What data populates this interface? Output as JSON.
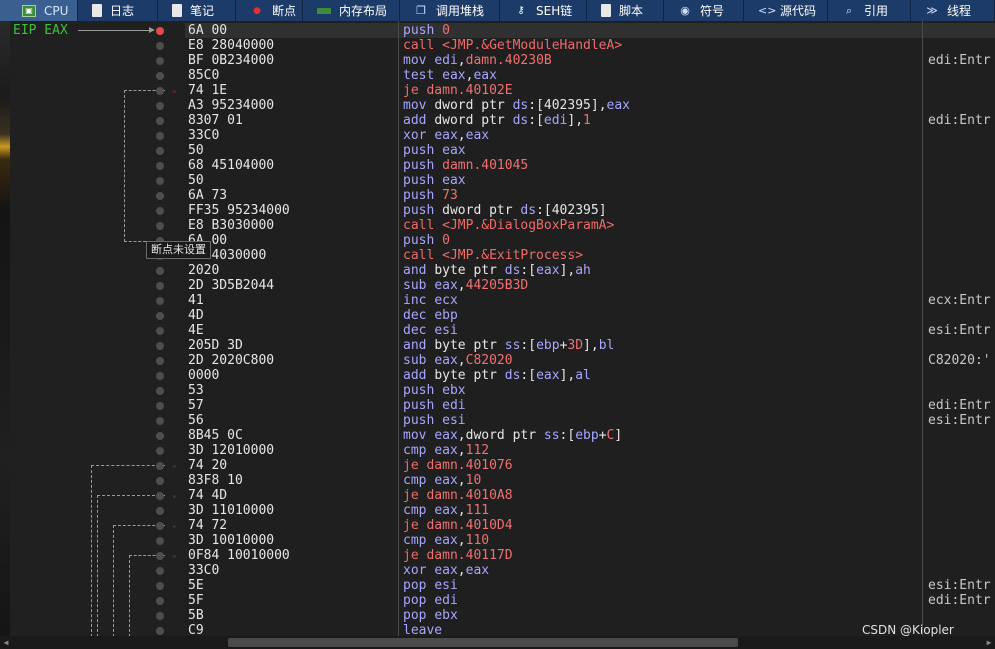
{
  "tabs": [
    {
      "label": "CPU",
      "icon": "cpu-icon",
      "active": true
    },
    {
      "label": "日志",
      "icon": "log-icon"
    },
    {
      "label": "笔记",
      "icon": "notes-icon"
    },
    {
      "label": "断点",
      "icon": "breakpoint-icon"
    },
    {
      "label": "内存布局",
      "icon": "memory-map-icon"
    },
    {
      "label": "调用堆栈",
      "icon": "call-stack-icon"
    },
    {
      "label": "SEH链",
      "icon": "seh-chain-icon"
    },
    {
      "label": "脚本",
      "icon": "script-icon"
    },
    {
      "label": "符号",
      "icon": "symbols-icon"
    },
    {
      "label": "源代码",
      "icon": "source-code-icon"
    },
    {
      "label": "引用",
      "icon": "references-icon"
    },
    {
      "label": "线程",
      "icon": "threads-icon"
    }
  ],
  "eip_label": "EIP EAX",
  "tooltip": "断点未设置",
  "watermark": "CSDN @Kiopler",
  "rows": [
    {
      "bytes": "6A 00",
      "op": "push",
      "args": [
        {
          "t": "0",
          "c": "arg-red"
        }
      ],
      "cmt": "",
      "bp": true
    },
    {
      "bytes": "E8 28040000",
      "op": "call",
      "kind": "call",
      "args": [
        {
          "t": "<JMP.&GetModuleHandleA>",
          "c": "op-call"
        }
      ],
      "cmt": ""
    },
    {
      "bytes": "BF 0B234000",
      "op": "mov",
      "args": [
        {
          "t": "edi",
          "c": "op-norm"
        },
        {
          "t": ",",
          "c": "arg"
        },
        {
          "t": "damn.40230B",
          "c": "arg-red"
        }
      ],
      "cmt": "edi:Entr"
    },
    {
      "bytes": "85C0",
      "op": "test",
      "args": [
        {
          "t": "eax",
          "c": "op-norm"
        },
        {
          "t": ",",
          "c": "arg"
        },
        {
          "t": "eax",
          "c": "op-norm"
        }
      ],
      "cmt": ""
    },
    {
      "bytes": "74 1E",
      "op": "je",
      "kind": "jmp",
      "args": [
        {
          "t": "damn.40102E",
          "c": "arg-red"
        }
      ],
      "cmt": ""
    },
    {
      "bytes": "A3 95234000",
      "op": "mov",
      "args": [
        {
          "t": "dword ptr ",
          "c": "arg"
        },
        {
          "t": "ds",
          "c": "op-norm"
        },
        {
          "t": ":[402395],",
          "c": "arg"
        },
        {
          "t": "eax",
          "c": "op-norm"
        }
      ],
      "cmt": ""
    },
    {
      "bytes": "8307 01",
      "op": "add",
      "args": [
        {
          "t": "dword ptr ",
          "c": "arg"
        },
        {
          "t": "ds",
          "c": "op-norm"
        },
        {
          "t": ":[",
          "c": "arg"
        },
        {
          "t": "edi",
          "c": "op-norm"
        },
        {
          "t": "],",
          "c": "arg"
        },
        {
          "t": "1",
          "c": "arg-red"
        }
      ],
      "cmt": "edi:Entr"
    },
    {
      "bytes": "33C0",
      "op": "xor",
      "args": [
        {
          "t": "eax",
          "c": "op-norm"
        },
        {
          "t": ",",
          "c": "arg"
        },
        {
          "t": "eax",
          "c": "op-norm"
        }
      ],
      "cmt": ""
    },
    {
      "bytes": "50",
      "op": "push",
      "args": [
        {
          "t": "eax",
          "c": "op-norm"
        }
      ],
      "cmt": ""
    },
    {
      "bytes": "68 45104000",
      "op": "push",
      "args": [
        {
          "t": "damn.401045",
          "c": "arg-red"
        }
      ],
      "cmt": ""
    },
    {
      "bytes": "50",
      "op": "push",
      "args": [
        {
          "t": "eax",
          "c": "op-norm"
        }
      ],
      "cmt": ""
    },
    {
      "bytes": "6A 73",
      "op": "push",
      "args": [
        {
          "t": "73",
          "c": "arg-red"
        }
      ],
      "cmt": ""
    },
    {
      "bytes": "FF35 95234000",
      "op": "push",
      "args": [
        {
          "t": "dword ptr ",
          "c": "arg"
        },
        {
          "t": "ds",
          "c": "op-norm"
        },
        {
          "t": ":[402395]",
          "c": "arg"
        }
      ],
      "cmt": ""
    },
    {
      "bytes": "E8 B3030000",
      "op": "call",
      "kind": "call",
      "args": [
        {
          "t": "<JMP.&DialogBoxParamA>",
          "c": "op-call"
        }
      ],
      "cmt": ""
    },
    {
      "bytes": "6A 00",
      "op": "push",
      "args": [
        {
          "t": "0",
          "c": "arg-red"
        }
      ],
      "cmt": ""
    },
    {
      "bytes": "E8 4030000",
      "op": "call",
      "kind": "call",
      "args": [
        {
          "t": "<JMP.&ExitProcess>",
          "c": "op-call"
        }
      ],
      "cmt": ""
    },
    {
      "bytes": "2020",
      "op": "and",
      "args": [
        {
          "t": "byte ptr ",
          "c": "arg"
        },
        {
          "t": "ds",
          "c": "op-norm"
        },
        {
          "t": ":[",
          "c": "arg"
        },
        {
          "t": "eax",
          "c": "op-norm"
        },
        {
          "t": "],",
          "c": "arg"
        },
        {
          "t": "ah",
          "c": "op-norm"
        }
      ],
      "cmt": ""
    },
    {
      "bytes": "2D 3D5B2044",
      "op": "sub",
      "args": [
        {
          "t": "eax",
          "c": "op-norm"
        },
        {
          "t": ",",
          "c": "arg"
        },
        {
          "t": "44205B3D",
          "c": "arg-red"
        }
      ],
      "cmt": ""
    },
    {
      "bytes": "41",
      "op": "inc",
      "args": [
        {
          "t": "ecx",
          "c": "op-norm"
        }
      ],
      "cmt": "ecx:Entr"
    },
    {
      "bytes": "4D",
      "op": "dec",
      "args": [
        {
          "t": "ebp",
          "c": "op-norm"
        }
      ],
      "cmt": ""
    },
    {
      "bytes": "4E",
      "op": "dec",
      "args": [
        {
          "t": "esi",
          "c": "op-norm"
        }
      ],
      "cmt": "esi:Entr"
    },
    {
      "bytes": "205D 3D",
      "op": "and",
      "args": [
        {
          "t": "byte ptr ",
          "c": "arg"
        },
        {
          "t": "ss",
          "c": "op-norm"
        },
        {
          "t": ":[",
          "c": "arg"
        },
        {
          "t": "ebp",
          "c": "op-norm"
        },
        {
          "t": "+",
          "c": "arg"
        },
        {
          "t": "3D",
          "c": "arg-red"
        },
        {
          "t": "],",
          "c": "arg"
        },
        {
          "t": "bl",
          "c": "op-norm"
        }
      ],
      "cmt": ""
    },
    {
      "bytes": "2D 2020C800",
      "op": "sub",
      "args": [
        {
          "t": "eax",
          "c": "op-norm"
        },
        {
          "t": ",",
          "c": "arg"
        },
        {
          "t": "C82020",
          "c": "arg-red"
        }
      ],
      "cmt": "C82020:'"
    },
    {
      "bytes": "0000",
      "op": "add",
      "args": [
        {
          "t": "byte ptr ",
          "c": "arg"
        },
        {
          "t": "ds",
          "c": "op-norm"
        },
        {
          "t": ":[",
          "c": "arg"
        },
        {
          "t": "eax",
          "c": "op-norm"
        },
        {
          "t": "],",
          "c": "arg"
        },
        {
          "t": "al",
          "c": "op-norm"
        }
      ],
      "cmt": ""
    },
    {
      "bytes": "53",
      "op": "push",
      "args": [
        {
          "t": "ebx",
          "c": "op-norm"
        }
      ],
      "cmt": ""
    },
    {
      "bytes": "57",
      "op": "push",
      "args": [
        {
          "t": "edi",
          "c": "op-norm"
        }
      ],
      "cmt": "edi:Entr"
    },
    {
      "bytes": "56",
      "op": "push",
      "args": [
        {
          "t": "esi",
          "c": "op-norm"
        }
      ],
      "cmt": "esi:Entr"
    },
    {
      "bytes": "8B45 0C",
      "op": "mov",
      "args": [
        {
          "t": "eax",
          "c": "op-norm"
        },
        {
          "t": ",dword ptr ",
          "c": "arg"
        },
        {
          "t": "ss",
          "c": "op-norm"
        },
        {
          "t": ":[",
          "c": "arg"
        },
        {
          "t": "ebp",
          "c": "op-norm"
        },
        {
          "t": "+",
          "c": "arg"
        },
        {
          "t": "C",
          "c": "arg-red"
        },
        {
          "t": "]",
          "c": "arg"
        }
      ],
      "cmt": ""
    },
    {
      "bytes": "3D 12010000",
      "op": "cmp",
      "args": [
        {
          "t": "eax",
          "c": "op-norm"
        },
        {
          "t": ",",
          "c": "arg"
        },
        {
          "t": "112",
          "c": "arg-red"
        }
      ],
      "cmt": ""
    },
    {
      "bytes": "74 20",
      "op": "je",
      "kind": "jmp",
      "args": [
        {
          "t": "damn.401076",
          "c": "arg-red"
        }
      ],
      "cmt": ""
    },
    {
      "bytes": "83F8 10",
      "op": "cmp",
      "args": [
        {
          "t": "eax",
          "c": "op-norm"
        },
        {
          "t": ",",
          "c": "arg"
        },
        {
          "t": "10",
          "c": "arg-red"
        }
      ],
      "cmt": ""
    },
    {
      "bytes": "74 4D",
      "op": "je",
      "kind": "jmp",
      "args": [
        {
          "t": "damn.4010A8",
          "c": "arg-red"
        }
      ],
      "cmt": ""
    },
    {
      "bytes": "3D 11010000",
      "op": "cmp",
      "args": [
        {
          "t": "eax",
          "c": "op-norm"
        },
        {
          "t": ",",
          "c": "arg"
        },
        {
          "t": "111",
          "c": "arg-red"
        }
      ],
      "cmt": ""
    },
    {
      "bytes": "74 72",
      "op": "je",
      "kind": "jmp",
      "args": [
        {
          "t": "damn.4010D4",
          "c": "arg-red"
        }
      ],
      "cmt": ""
    },
    {
      "bytes": "3D 10010000",
      "op": "cmp",
      "args": [
        {
          "t": "eax",
          "c": "op-norm"
        },
        {
          "t": ",",
          "c": "arg"
        },
        {
          "t": "110",
          "c": "arg-red"
        }
      ],
      "cmt": ""
    },
    {
      "bytes": "0F84 10010000",
      "op": "je",
      "kind": "jmp",
      "args": [
        {
          "t": "damn.40117D",
          "c": "arg-red"
        }
      ],
      "cmt": ""
    },
    {
      "bytes": "33C0",
      "op": "xor",
      "args": [
        {
          "t": "eax",
          "c": "op-norm"
        },
        {
          "t": ",",
          "c": "arg"
        },
        {
          "t": "eax",
          "c": "op-norm"
        }
      ],
      "cmt": ""
    },
    {
      "bytes": "5E",
      "op": "pop",
      "args": [
        {
          "t": "esi",
          "c": "op-norm"
        }
      ],
      "cmt": "esi:Entr"
    },
    {
      "bytes": "5F",
      "op": "pop",
      "args": [
        {
          "t": "edi",
          "c": "op-norm"
        }
      ],
      "cmt": "edi:Entr"
    },
    {
      "bytes": "5B",
      "op": "pop",
      "args": [
        {
          "t": "ebx",
          "c": "op-norm"
        }
      ],
      "cmt": ""
    },
    {
      "bytes": "C9",
      "op": "leave",
      "args": [],
      "cmt": ""
    }
  ]
}
